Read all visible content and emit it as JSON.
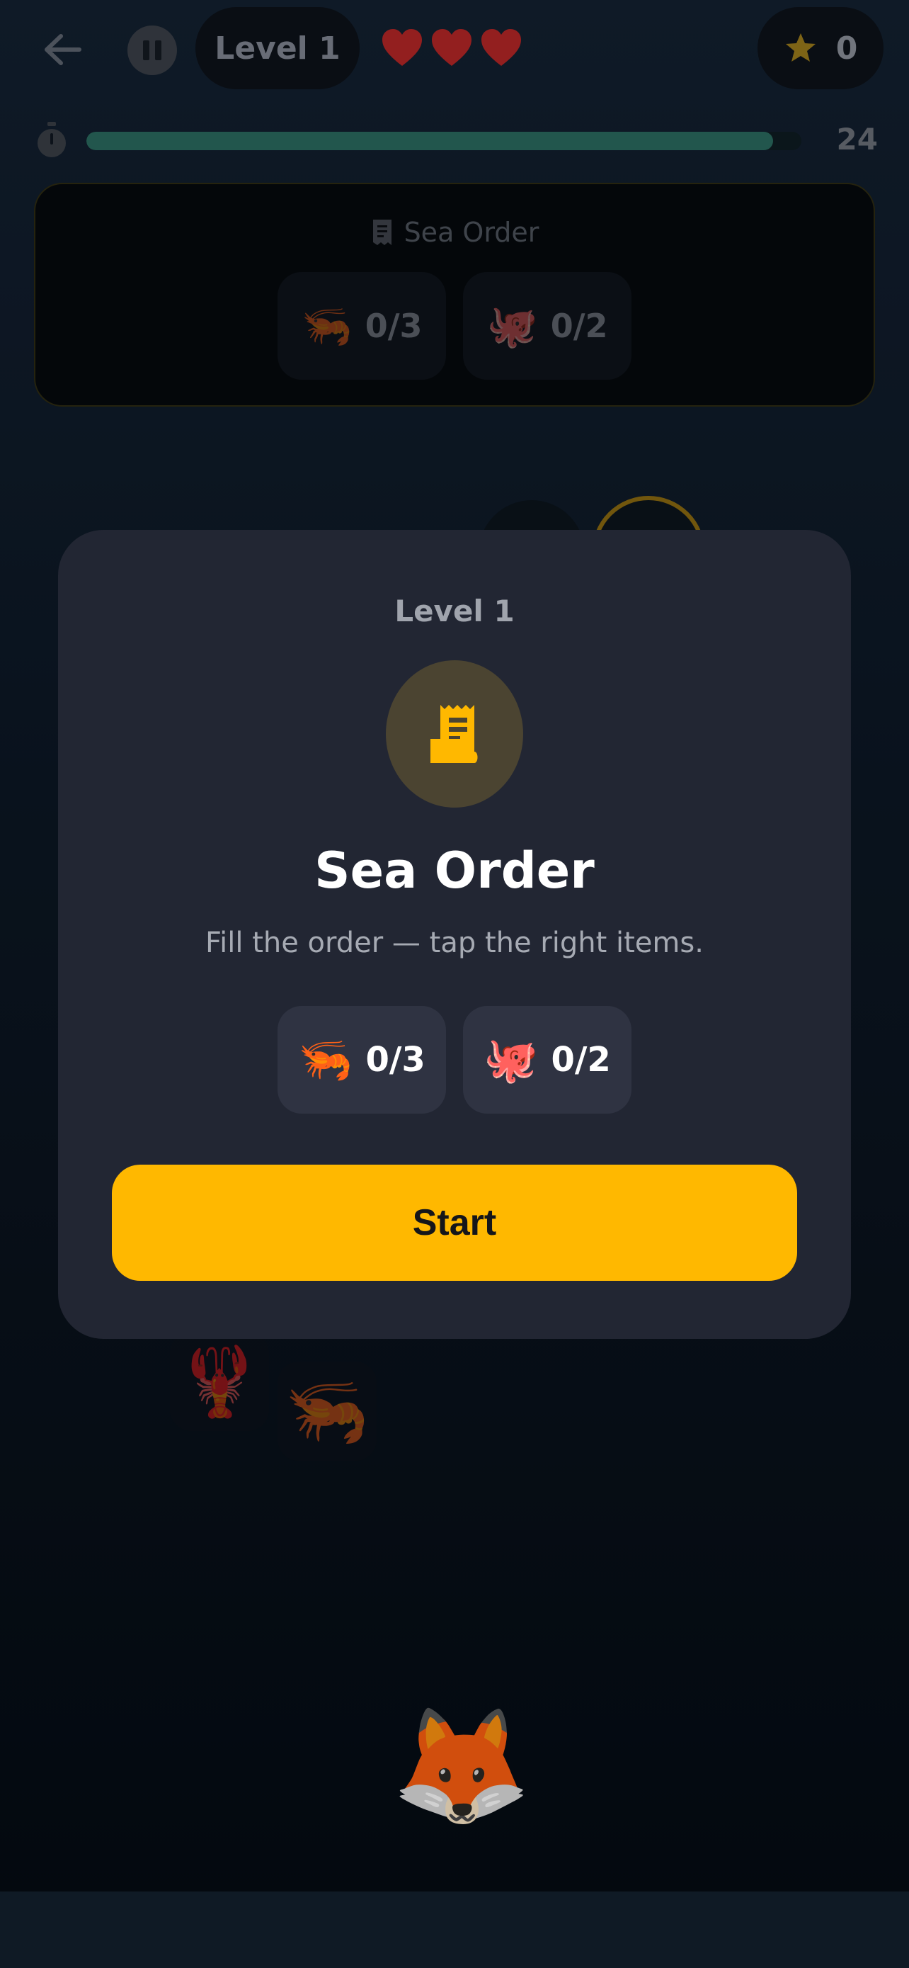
{
  "hud": {
    "level_label": "Level 1",
    "hearts_count": 3,
    "star_count": "0",
    "timer_value": "24",
    "timer_progress": 0.96
  },
  "order_card": {
    "title": "Sea Order",
    "items": [
      {
        "emoji": "🦐",
        "progress": "0/3"
      },
      {
        "emoji": "🐙",
        "progress": "0/2"
      }
    ]
  },
  "board": {
    "tiles": [
      {
        "emoji": "🦞"
      },
      {
        "emoji": "🦐"
      }
    ],
    "player_emoji": "🦊"
  },
  "modal": {
    "level_label": "Level 1",
    "title": "Sea Order",
    "subtitle": "Fill the order — tap the right items.",
    "items": [
      {
        "emoji": "🦐",
        "progress": "0/3"
      },
      {
        "emoji": "🐙",
        "progress": "0/2"
      }
    ],
    "start_label": "Start"
  },
  "colors": {
    "accent": "#ffb800",
    "heart": "#c92b2b",
    "progress": "#2a6a5f",
    "modal_bg": "#222633"
  }
}
